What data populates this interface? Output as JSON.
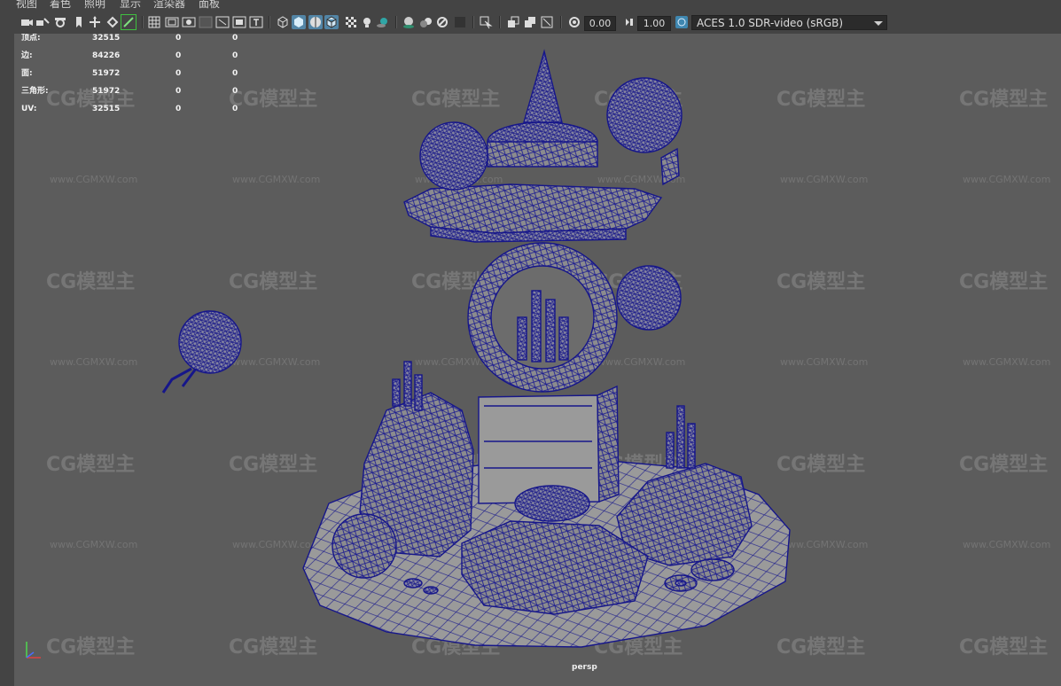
{
  "menu": [
    "视图",
    "着色",
    "照明",
    "显示",
    "渲染器",
    "面板"
  ],
  "toolbar": {
    "exposure_value": "0.00",
    "gamma_value": "1.00",
    "color_space": "ACES 1.0 SDR-video (sRGB)",
    "icons": [
      "camera-icon",
      "camera-attributes-icon",
      "bookmark-icon",
      "image-plane-icon",
      "grid-icon",
      "film-gate-icon",
      "resolution-gate-icon",
      "gate-mask-icon",
      "field-chart-icon",
      "safe-action-icon",
      "safe-title-icon",
      "wireframe-icon",
      "smooth-shade-icon",
      "wireframe-on-shaded-icon",
      "xray-icon",
      "default-lighting-icon",
      "shadows-icon",
      "ambient-occlusion-icon",
      "motion-blur-icon",
      "anti-aliasing-icon",
      "depth-of-field-icon",
      "isolate-select-icon",
      "xray-joints-icon",
      "xray-active-icon",
      "exposure-icon",
      "gamma-icon",
      "color-management-icon"
    ]
  },
  "hud": {
    "rows": [
      {
        "label": "顶点:",
        "v1": "32515",
        "v2": "0",
        "v3": "0"
      },
      {
        "label": "边:",
        "v1": "84226",
        "v2": "0",
        "v3": "0"
      },
      {
        "label": "面:",
        "v1": "51972",
        "v2": "0",
        "v3": "0"
      },
      {
        "label": "三角形:",
        "v1": "51972",
        "v2": "0",
        "v3": "0"
      },
      {
        "label": "UV:",
        "v1": "32515",
        "v2": "0",
        "v3": "0"
      }
    ]
  },
  "watermark": {
    "logo": "CG模型主",
    "url": "www.CGMXW.com"
  },
  "camera_label": "persp",
  "colors": {
    "wire": "#1a1a8c",
    "mesh_fill": "#8a8a8a",
    "viewport_bg": "#5c5c5c",
    "panel_bg": "#444444",
    "active_icon": "#5285a6"
  }
}
